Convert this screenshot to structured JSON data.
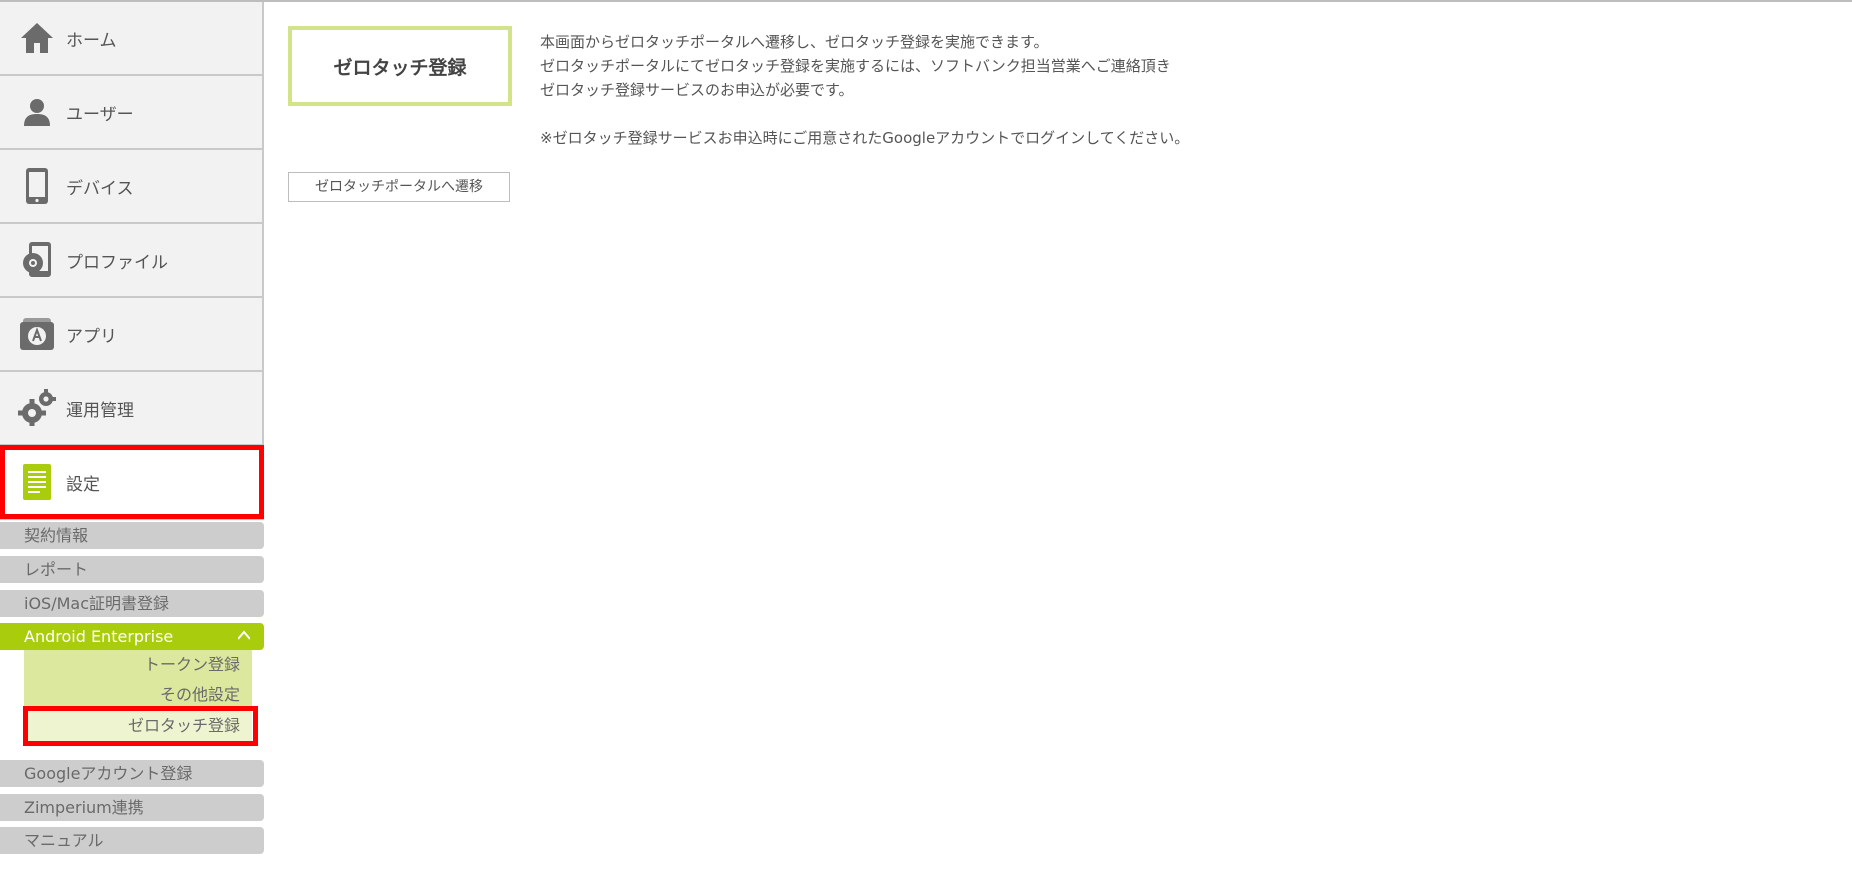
{
  "sidebar": {
    "items": [
      {
        "label": "ホーム",
        "icon": "home-icon"
      },
      {
        "label": "ユーザー",
        "icon": "user-icon"
      },
      {
        "label": "デバイス",
        "icon": "smartphone-icon"
      },
      {
        "label": "プロファイル",
        "icon": "profile-icon"
      },
      {
        "label": "アプリ",
        "icon": "app-icon"
      },
      {
        "label": "運用管理",
        "icon": "gears-icon"
      },
      {
        "label": "設定",
        "icon": "document-icon"
      }
    ],
    "settings_sub": [
      {
        "label": "契約情報"
      },
      {
        "label": "レポート"
      },
      {
        "label": "iOS/Mac証明書登録"
      },
      {
        "label": "Android Enterprise"
      },
      {
        "label": "Googleアカウント登録"
      },
      {
        "label": "Zimperium連携"
      },
      {
        "label": "マニュアル"
      }
    ],
    "android_sub": [
      {
        "label": "トークン登録"
      },
      {
        "label": "その他設定"
      },
      {
        "label": "ゼロタッチ登録"
      }
    ]
  },
  "main": {
    "title": "ゼロタッチ登録",
    "description": [
      "本画面からゼロタッチポータルへ遷移し、ゼロタッチ登録を実施できます。",
      "ゼロタッチポータルにてゼロタッチ登録を実施するには、ソフトバンク担当営業へご連絡頂き",
      "ゼロタッチ登録サービスのお申込が必要です。",
      "※ゼロタッチ登録サービスお申込時にご用意されたGoogleアカウントでログインしてください。"
    ],
    "portal_button": "ゼロタッチポータルへ遷移"
  },
  "colors": {
    "accent_green": "#a9cc0c",
    "highlight_red": "#ff0000",
    "title_border": "#d3e38a"
  }
}
